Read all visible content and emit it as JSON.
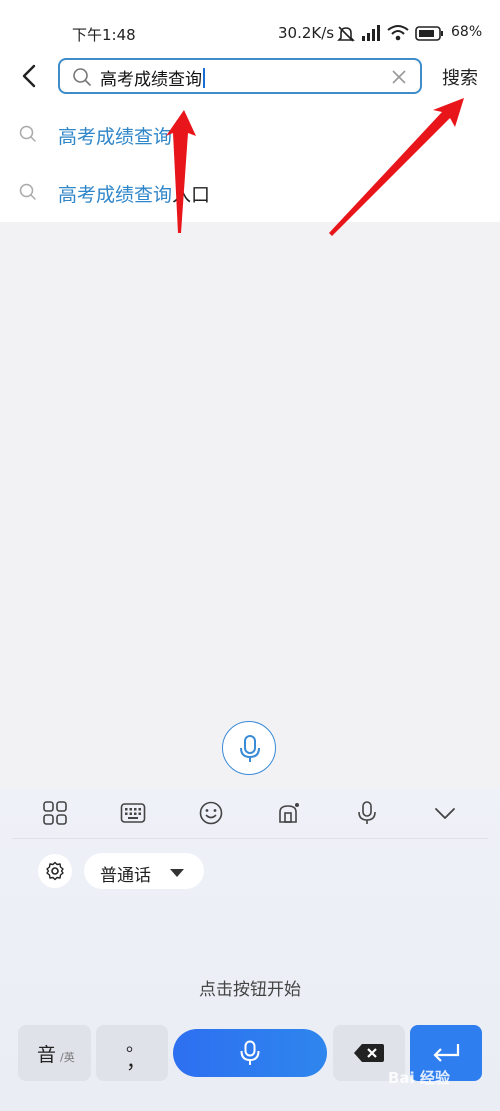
{
  "status_bar": {
    "time": "下午1:48",
    "network_speed": "30.2K/s",
    "battery_percent": "68%"
  },
  "header": {
    "search_query": "高考成绩查询",
    "search_button_label": "搜索"
  },
  "suggestions": [
    {
      "highlight": "高考成绩查询",
      "rest": ""
    },
    {
      "highlight": "高考成绩查询",
      "rest": "入口"
    }
  ],
  "keyboard": {
    "language_label": "普通话",
    "hint": "点击按钮开始",
    "keys": {
      "yin_label": "音",
      "yin_sub": "/英",
      "punct_top": "。",
      "punct_bottom": "，"
    },
    "toolbar_icons": [
      "grid-icon",
      "keyboard-icon",
      "emoji-icon",
      "tool-icon",
      "microphone-icon",
      "chevron-down-icon"
    ]
  },
  "watermark": "Bai 经验",
  "colors": {
    "accent": "#2f86c9",
    "voice_button": "#2d6ff0",
    "annotation_arrow": "#e8151a"
  }
}
